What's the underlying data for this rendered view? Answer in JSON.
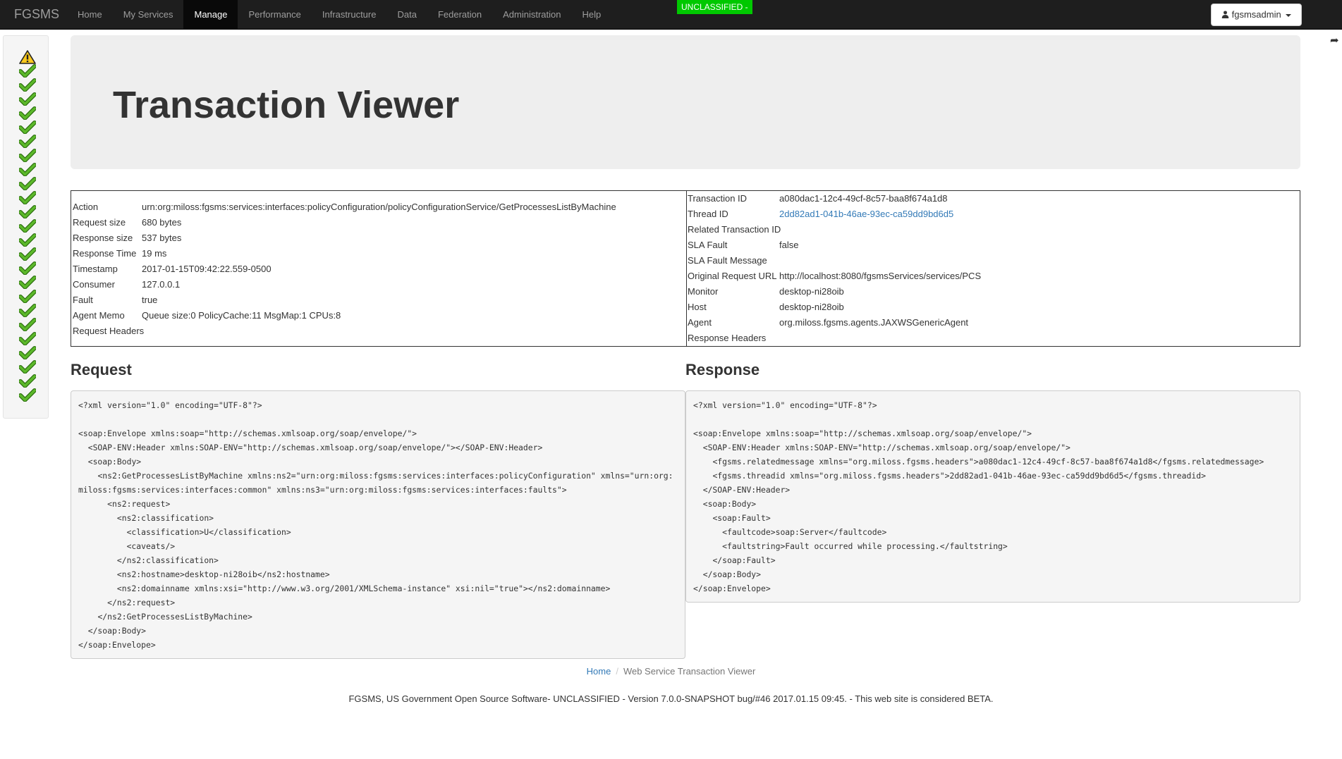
{
  "navbar": {
    "brand": "FGSMS",
    "items": [
      "Home",
      "My Services",
      "Manage",
      "Performance",
      "Infrastructure",
      "Data",
      "Federation",
      "Administration",
      "Help"
    ],
    "active": "Manage",
    "classification": "UNCLASSIFIED -",
    "user": "fgsmsadmin",
    "colors": {
      "navbar": "#1e1e1e",
      "classification": "#00c800",
      "link": "#337ab7"
    }
  },
  "sidebar": {
    "statuses": [
      "warning",
      "ok",
      "ok",
      "ok",
      "ok",
      "ok",
      "ok",
      "ok",
      "ok",
      "ok",
      "ok",
      "ok",
      "ok",
      "ok",
      "ok",
      "ok",
      "ok",
      "ok",
      "ok",
      "ok",
      "ok",
      "ok",
      "ok",
      "ok",
      "ok"
    ]
  },
  "page": {
    "title": "Transaction Viewer"
  },
  "left_details": [
    {
      "label": "Action",
      "value": "urn:org:miloss:fgsms:services:interfaces:policyConfiguration/policyConfigurationService/GetProcessesListByMachine"
    },
    {
      "label": "Request size",
      "value": "680 bytes"
    },
    {
      "label": "Response size",
      "value": "537 bytes"
    },
    {
      "label": "Response Time",
      "value": "19 ms"
    },
    {
      "label": "Timestamp",
      "value": "2017-01-15T09:42:22.559-0500"
    },
    {
      "label": "Consumer",
      "value": "127.0.0.1"
    },
    {
      "label": "Fault",
      "value": "true"
    },
    {
      "label": "Agent Memo",
      "value": "Queue size:0 PolicyCache:11 MsgMap:1 CPUs:8"
    },
    {
      "label": "Request Headers",
      "value": ""
    }
  ],
  "right_details": [
    {
      "label": "Transaction ID",
      "value": "a080dac1-12c4-49cf-8c57-baa8f674a1d8"
    },
    {
      "label": "Thread ID",
      "value": "2dd82ad1-041b-46ae-93ec-ca59dd9bd6d5",
      "link": true
    },
    {
      "label": "Related Transaction ID",
      "value": ""
    },
    {
      "label": "SLA Fault",
      "value": "false"
    },
    {
      "label": "SLA Fault Message",
      "value": ""
    },
    {
      "label": "Original Request URL",
      "value": "http://localhost:8080/fgsmsServices/services/PCS"
    },
    {
      "label": "Monitor",
      "value": "desktop-ni28oib"
    },
    {
      "label": "Host",
      "value": "desktop-ni28oib"
    },
    {
      "label": "Agent",
      "value": "org.miloss.fgsms.agents.JAXWSGenericAgent"
    },
    {
      "label": "Response Headers",
      "value": ""
    }
  ],
  "request": {
    "title": "Request",
    "xml": "<?xml version=\"1.0\" encoding=\"UTF-8\"?>\n\n<soap:Envelope xmlns:soap=\"http://schemas.xmlsoap.org/soap/envelope/\">\n  <SOAP-ENV:Header xmlns:SOAP-ENV=\"http://schemas.xmlsoap.org/soap/envelope/\"></SOAP-ENV:Header>\n  <soap:Body>\n    <ns2:GetProcessesListByMachine xmlns:ns2=\"urn:org:miloss:fgsms:services:interfaces:policyConfiguration\" xmlns=\"urn:org:miloss:fgsms:services:interfaces:common\" xmlns:ns3=\"urn:org:miloss:fgsms:services:interfaces:faults\">\n      <ns2:request>\n        <ns2:classification>\n          <classification>U</classification>\n          <caveats/>\n        </ns2:classification>\n        <ns2:hostname>desktop-ni28oib</ns2:hostname>\n        <ns2:domainname xmlns:xsi=\"http://www.w3.org/2001/XMLSchema-instance\" xsi:nil=\"true\"></ns2:domainname>\n      </ns2:request>\n    </ns2:GetProcessesListByMachine>\n  </soap:Body>\n</soap:Envelope>"
  },
  "response": {
    "title": "Response",
    "xml": "<?xml version=\"1.0\" encoding=\"UTF-8\"?>\n\n<soap:Envelope xmlns:soap=\"http://schemas.xmlsoap.org/soap/envelope/\">\n  <SOAP-ENV:Header xmlns:SOAP-ENV=\"http://schemas.xmlsoap.org/soap/envelope/\">\n    <fgsms.relatedmessage xmlns=\"org.miloss.fgsms.headers\">a080dac1-12c4-49cf-8c57-baa8f674a1d8</fgsms.relatedmessage>\n    <fgsms.threadid xmlns=\"org.miloss.fgsms.headers\">2dd82ad1-041b-46ae-93ec-ca59dd9bd6d5</fgsms.threadid>\n  </SOAP-ENV:Header>\n  <soap:Body>\n    <soap:Fault>\n      <faultcode>soap:Server</faultcode>\n      <faultstring>Fault occurred while processing.</faultstring>\n    </soap:Fault>\n  </soap:Body>\n</soap:Envelope>"
  },
  "breadcrumb": {
    "home": "Home",
    "current": "Web Service Transaction Viewer"
  },
  "footer": "FGSMS, US Government Open Source Software- UNCLASSIFIED - Version 7.0.0-SNAPSHOT bug/#46 2017.01.15 09:45. - This web site is considered BETA."
}
